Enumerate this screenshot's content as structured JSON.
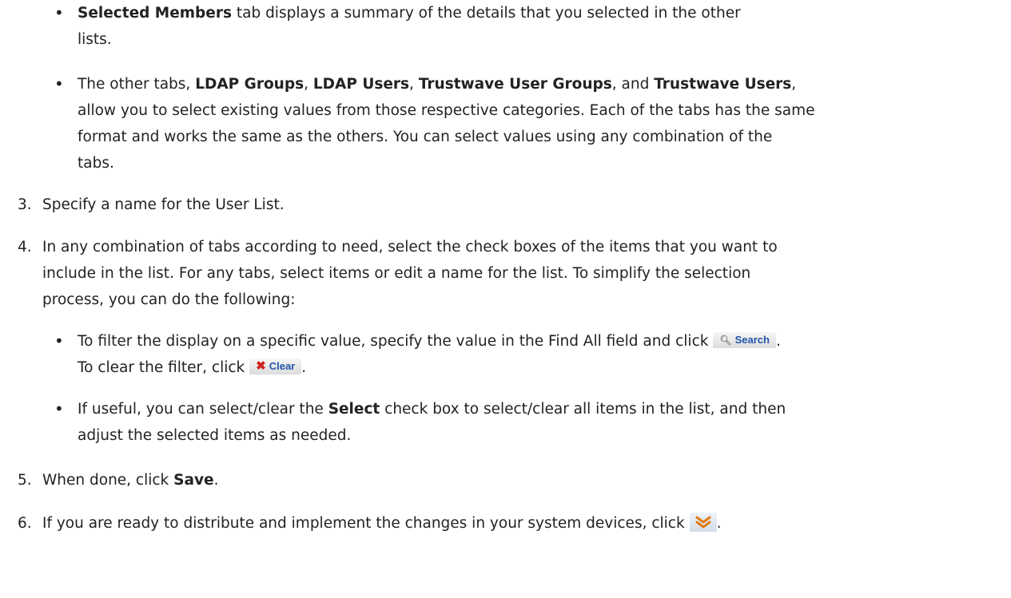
{
  "bullet_char": "•",
  "b1": {
    "bold": "Selected Members",
    "rest": " tab displays a summary of the details that you selected in the other",
    "cont": "lists."
  },
  "b2": {
    "pre": "The other tabs, ",
    "t1": "LDAP Groups",
    "c1": ", ",
    "t2": "LDAP Users",
    "c2": ", ",
    "t3": "Trustwave User Groups",
    "c3": ", and ",
    "t4": "Trustwave Users",
    "c4": ",",
    "l2": "allow you to select existing values from those respective categories. Each of the tabs has the same",
    "l3": "format and works the same as the others. You can select values using any combination of the",
    "l4": "tabs."
  },
  "s3": {
    "num": "3.",
    "text": "Specify a name for the User List."
  },
  "s4": {
    "num": "4.",
    "l1": "In any combination of tabs according to need, select the check boxes of the items that you want to",
    "l2": "include in the list. For any tabs, select items or edit a name for the list. To simplify the selection",
    "l3": "process, you can do the following:"
  },
  "s4b1": {
    "pre": "To filter the display on a specific value, specify the value in the Find All field and click ",
    "search_label": "Search",
    "post": ".",
    "l2pre": "To clear the filter, click ",
    "clear_label": "Clear",
    "l2post": "."
  },
  "s4b2": {
    "pre": "If useful, you can select/clear the ",
    "bold": "Select",
    "post": " check box to select/clear all items in the list, and then",
    "l2": "adjust the selected items as needed."
  },
  "s5": {
    "num": "5.",
    "pre": "When done, click ",
    "bold": "Save",
    "post": "."
  },
  "s6": {
    "num": "6.",
    "text": "If you are ready to distribute and implement the changes in your system devices, click ",
    "post": "."
  },
  "icons": {
    "search": "magnifier-icon",
    "clear": "red-x-icon",
    "distribute": "double-chevron-down-icon"
  }
}
